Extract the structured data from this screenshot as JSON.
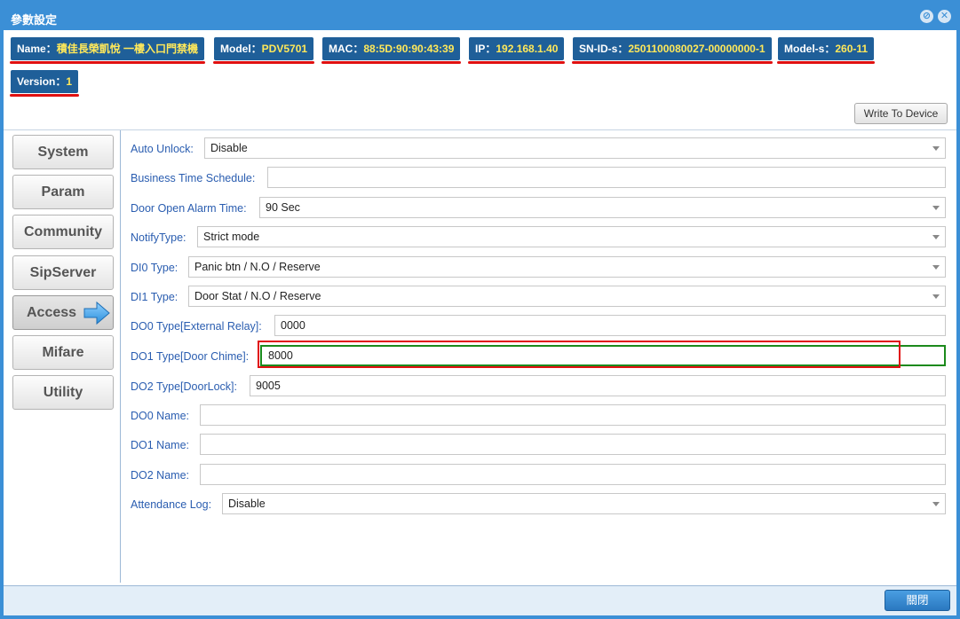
{
  "window": {
    "title": "參數設定"
  },
  "info": {
    "name": {
      "label": "Name：",
      "value": "積佳長榮凱悅 一樓入口門禁機"
    },
    "model": {
      "label": "Model：",
      "value": "PDV5701"
    },
    "mac": {
      "label": "MAC：",
      "value": "88:5D:90:90:43:39"
    },
    "ip": {
      "label": "IP：",
      "value": "192.168.1.40"
    },
    "snid": {
      "label": "SN-ID-s：",
      "value": "2501100080027-00000000-1"
    },
    "models": {
      "label": "Model-s：",
      "value": "260-11"
    },
    "version": {
      "label": "Version：",
      "value": "1"
    }
  },
  "toolbar": {
    "write_label": "Write To Device"
  },
  "nav": {
    "items": [
      "System",
      "Param",
      "Community",
      "SipServer",
      "Access",
      "Mifare",
      "Utility"
    ],
    "active": "Access"
  },
  "form": {
    "auto_unlock": {
      "label": "Auto Unlock:",
      "value": "Disable"
    },
    "business_time": {
      "label": "Business Time Schedule:",
      "value": ""
    },
    "door_open_alarm": {
      "label": "Door Open Alarm Time:",
      "value": "90 Sec"
    },
    "notify_type": {
      "label": "NotifyType:",
      "value": "Strict mode"
    },
    "di0_type": {
      "label": "DI0 Type:",
      "value": "Panic btn / N.O / Reserve"
    },
    "di1_type": {
      "label": "DI1 Type:",
      "value": "Door Stat / N.O / Reserve"
    },
    "do0_type": {
      "label": "DO0 Type[External Relay]:",
      "value": "0000"
    },
    "do1_type": {
      "label": "DO1 Type[Door Chime]:",
      "value": "8000"
    },
    "do2_type": {
      "label": "DO2 Type[DoorLock]:",
      "value": "9005"
    },
    "do0_name": {
      "label": "DO0 Name:",
      "value": ""
    },
    "do1_name": {
      "label": "DO1 Name:",
      "value": ""
    },
    "do2_name": {
      "label": "DO2 Name:",
      "value": ""
    },
    "attendance_log": {
      "label": "Attendance Log:",
      "value": "Disable"
    }
  },
  "footer": {
    "close_label": "關閉"
  },
  "colors": {
    "title_bar": "#3b8fd6",
    "badge": "#1f5f99",
    "badge_value": "#ffe85a",
    "highlight_red": "#e01010",
    "focus_green": "#1c8a1c",
    "label_blue": "#2a5db0"
  }
}
